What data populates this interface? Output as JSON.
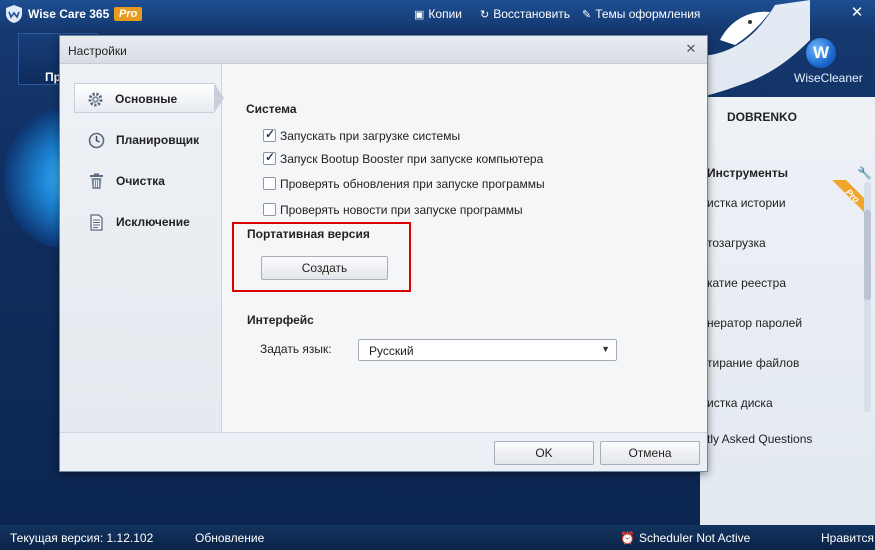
{
  "app": {
    "title": "Wise Care 365",
    "edition": "Pro",
    "toolbar": [
      {
        "label": "Копии",
        "icon": "save-icon"
      },
      {
        "label": "Восстановить",
        "icon": "restore-icon"
      },
      {
        "label": "Темы оформления",
        "icon": "theme-icon"
      }
    ],
    "close_glyph": "✕",
    "nav_tile_label": "Пр",
    "brand": {
      "logo_letter": "W",
      "name": "WiseCleaner"
    }
  },
  "right_panel": {
    "user": "DOBRENKO",
    "tools_title": "Инструменты",
    "pro_badge": "Pro",
    "tools": [
      "истка истории",
      "тозагрузка",
      "катие реестра",
      "нератор паролей",
      "тирание файлов",
      "истка диска"
    ],
    "faq": "tly Asked Questions"
  },
  "statusbar": {
    "version": "Текущая версия: 1.12.102",
    "update": "Обновление",
    "scheduler": "Scheduler Not Active",
    "like": "Нравится"
  },
  "dialog": {
    "title": "Настройки",
    "close_glyph": "✕",
    "sidebar": [
      {
        "label": "Основные",
        "icon": "gear-icon",
        "active": true
      },
      {
        "label": "Планировщик",
        "icon": "clock-icon",
        "active": false
      },
      {
        "label": "Очистка",
        "icon": "trash-icon",
        "active": false
      },
      {
        "label": "Исключение",
        "icon": "document-icon",
        "active": false
      }
    ],
    "system": {
      "title": "Система",
      "options": [
        {
          "label": "Запускать при загрузке системы",
          "checked": true
        },
        {
          "label": "Запуск Bootup Booster при запуске компьютера",
          "checked": true
        },
        {
          "label": "Проверять обновления при запуске программы",
          "checked": false
        },
        {
          "label": "Проверять новости при запуске программы",
          "checked": false
        }
      ]
    },
    "portable": {
      "title": "Портативная версия",
      "create_button": "Создать"
    },
    "interface": {
      "title": "Интерфейс",
      "language_label": "Задать язык:",
      "language_value": "Русский"
    },
    "footer": {
      "ok": "OK",
      "cancel": "Отмена"
    }
  },
  "colors": {
    "accent": "#1e4f93",
    "highlight": "#d80000",
    "pro": "#e89b1c"
  }
}
